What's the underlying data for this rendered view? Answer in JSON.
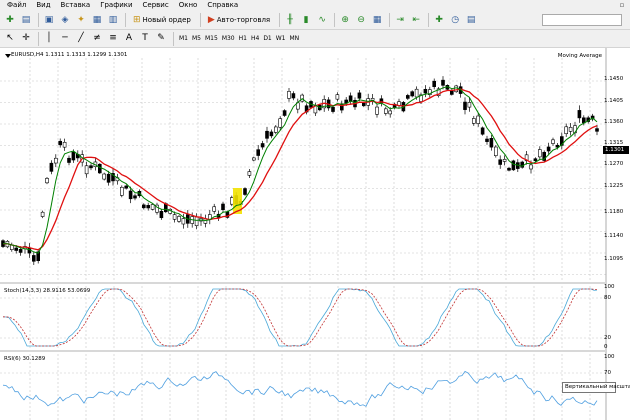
{
  "menu": [
    "Файл",
    "Вид",
    "Вставка",
    "Графики",
    "Сервис",
    "Окно",
    "Справка"
  ],
  "window_button": "▫",
  "toolbar": {
    "new_order": "Новый ордер",
    "auto_trading": "Авто-торговля",
    "timeframes": [
      "M1",
      "M5",
      "M15",
      "M30",
      "H1",
      "H4",
      "D1",
      "W1",
      "MN"
    ],
    "active_timeframe": "H4"
  },
  "chart": {
    "header": "EURUSD,H4  1.1311 1.1313 1.1299 1.1301",
    "ma_label": "Moving Average",
    "price_labels": [
      "1.1450",
      "1.1405",
      "1.1360",
      "1.1315",
      "1.1270",
      "1.1225",
      "1.1180",
      "1.1140",
      "1.1095"
    ],
    "current_price": "1.1301",
    "stoch_label": "Stoch(14,3,3) 28.9116 53.0699",
    "stoch_levels": [
      "100",
      "80",
      "20",
      "0"
    ],
    "rsi_label": "RSI(6) 30.1289",
    "rsi_levels": [
      "100",
      "70"
    ],
    "tooltip": "Вертикальный масштаб",
    "colors": {
      "bull": "#000000",
      "bear": "#000000",
      "ma_fast": "#008000",
      "ma_slow": "#e01010",
      "stoch_main": "#4aa8d8",
      "stoch_signal": "#c03030",
      "rsi": "#4f9fe0",
      "highlight": "#f2e200"
    }
  }
}
